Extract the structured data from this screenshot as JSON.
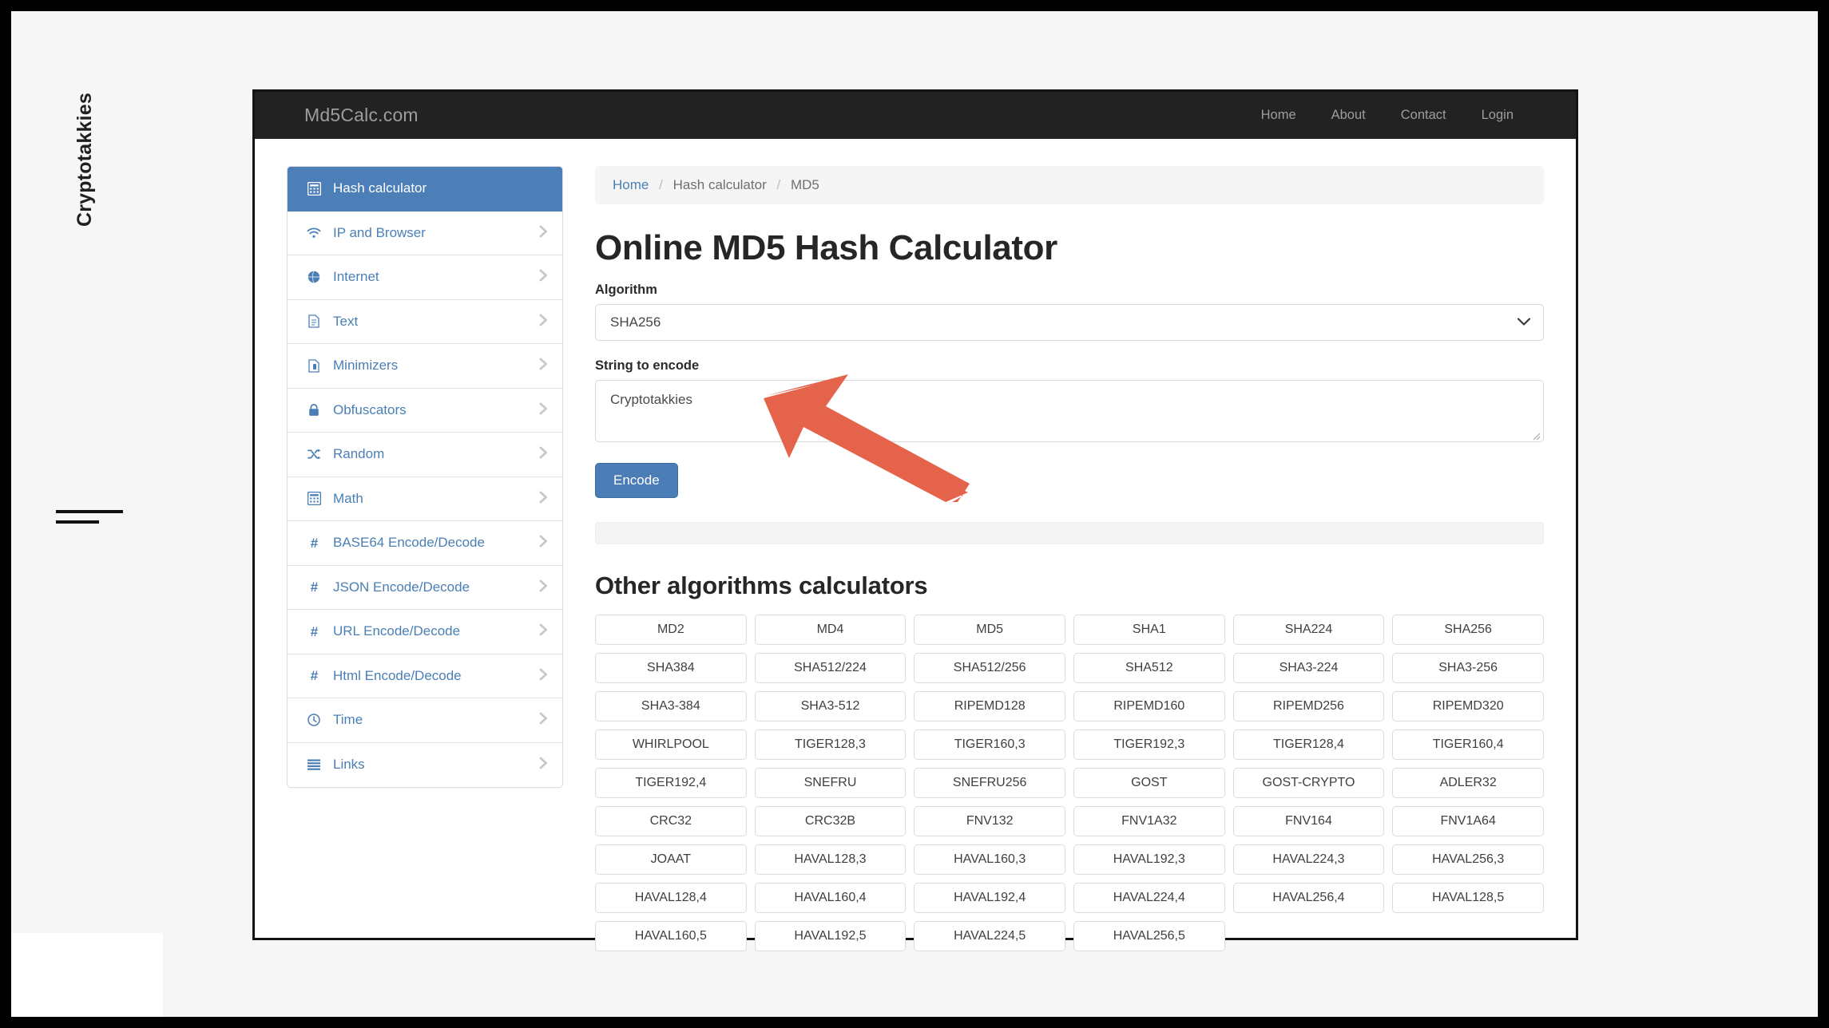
{
  "annotation": {
    "vertical_label": "Cryptotakkies",
    "arrow_color": "#e4634a"
  },
  "navbar": {
    "brand": "Md5Calc.com",
    "links": [
      {
        "label": "Home"
      },
      {
        "label": "About"
      },
      {
        "label": "Contact"
      },
      {
        "label": "Login"
      }
    ]
  },
  "sidebar": {
    "items": [
      {
        "label": "Hash calculator",
        "icon": "calculator-icon",
        "active": true,
        "chevron": false
      },
      {
        "label": "IP and Browser",
        "icon": "wifi-icon",
        "active": false,
        "chevron": true
      },
      {
        "label": "Internet",
        "icon": "globe-icon",
        "active": false,
        "chevron": true
      },
      {
        "label": "Text",
        "icon": "document-icon",
        "active": false,
        "chevron": true
      },
      {
        "label": "Minimizers",
        "icon": "compress-icon",
        "active": false,
        "chevron": true
      },
      {
        "label": "Obfuscators",
        "icon": "lock-icon",
        "active": false,
        "chevron": true
      },
      {
        "label": "Random",
        "icon": "shuffle-icon",
        "active": false,
        "chevron": true
      },
      {
        "label": "Math",
        "icon": "calculator-icon",
        "active": false,
        "chevron": true
      },
      {
        "label": "BASE64 Encode/Decode",
        "icon": "hash-icon",
        "active": false,
        "chevron": true
      },
      {
        "label": "JSON Encode/Decode",
        "icon": "hash-icon",
        "active": false,
        "chevron": true
      },
      {
        "label": "URL Encode/Decode",
        "icon": "hash-icon",
        "active": false,
        "chevron": true
      },
      {
        "label": "Html Encode/Decode",
        "icon": "hash-icon",
        "active": false,
        "chevron": true
      },
      {
        "label": "Time",
        "icon": "clock-icon",
        "active": false,
        "chevron": true
      },
      {
        "label": "Links",
        "icon": "list-icon",
        "active": false,
        "chevron": true
      }
    ]
  },
  "breadcrumb": {
    "home": "Home",
    "section": "Hash calculator",
    "current": "MD5",
    "separator": "/"
  },
  "main": {
    "title": "Online MD5 Hash Calculator",
    "algorithm_label": "Algorithm",
    "algorithm_value": "SHA256",
    "string_label": "String to encode",
    "string_value": "Cryptotakkies",
    "string_placeholder": "",
    "encode_button": "Encode",
    "other_title": "Other algorithms calculators"
  },
  "algorithms": [
    "MD2",
    "MD4",
    "MD5",
    "SHA1",
    "SHA224",
    "SHA256",
    "SHA384",
    "SHA512/224",
    "SHA512/256",
    "SHA512",
    "SHA3-224",
    "SHA3-256",
    "SHA3-384",
    "SHA3-512",
    "RIPEMD128",
    "RIPEMD160",
    "RIPEMD256",
    "RIPEMD320",
    "WHIRLPOOL",
    "TIGER128,3",
    "TIGER160,3",
    "TIGER192,3",
    "TIGER128,4",
    "TIGER160,4",
    "TIGER192,4",
    "SNEFRU",
    "SNEFRU256",
    "GOST",
    "GOST-CRYPTO",
    "ADLER32",
    "CRC32",
    "CRC32B",
    "FNV132",
    "FNV1A32",
    "FNV164",
    "FNV1A64",
    "JOAAT",
    "HAVAL128,3",
    "HAVAL160,3",
    "HAVAL192,3",
    "HAVAL224,3",
    "HAVAL256,3",
    "HAVAL128,4",
    "HAVAL160,4",
    "HAVAL192,4",
    "HAVAL224,4",
    "HAVAL256,4",
    "HAVAL128,5",
    "HAVAL160,5",
    "HAVAL192,5",
    "HAVAL224,5",
    "HAVAL256,5"
  ],
  "colors": {
    "accent_blue": "#4c7fb8",
    "navbar_bg": "#222222",
    "link_blue": "#4a7fb5",
    "arrow_orange": "#e4634a"
  }
}
